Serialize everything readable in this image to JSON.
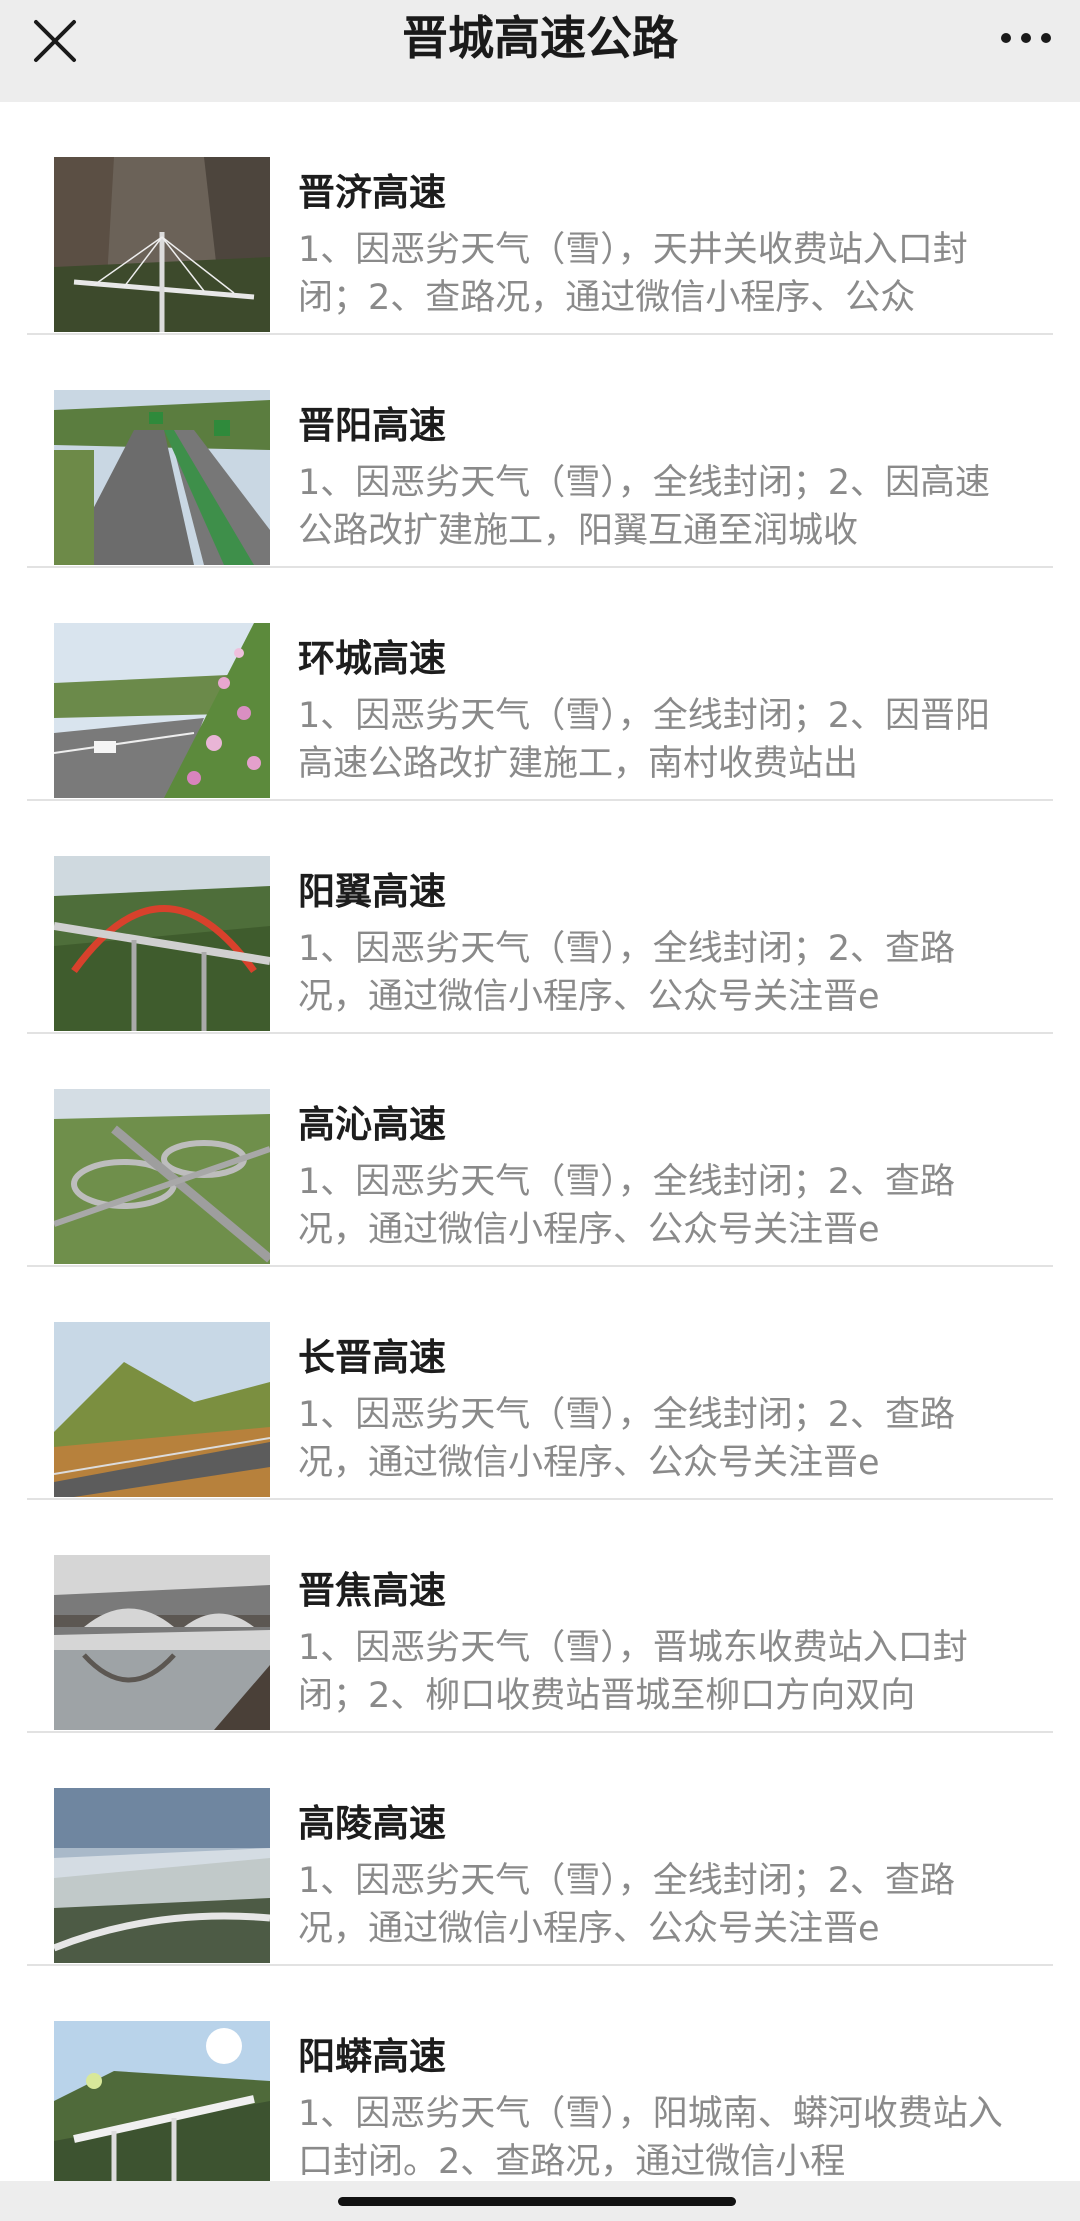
{
  "header": {
    "title": "晋城高速公路",
    "close_icon": "close-icon",
    "more_icon": "more-icon"
  },
  "roads": [
    {
      "name": "晋济高速",
      "desc": "1、因恶劣天气（雪），天井关收费站入口封闭；2、查路况，通过微信小程序、公众",
      "thumb": "bridge-cliff"
    },
    {
      "name": "晋阳高速",
      "desc": "1、因恶劣天气（雪），全线封闭；2、因高速公路改扩建施工，阳翼互通至润城收",
      "thumb": "highway-signs"
    },
    {
      "name": "环城高速",
      "desc": "1、因恶劣天气（雪），全线封闭；2、因晋阳高速公路改扩建施工，南村收费站出",
      "thumb": "highway-flowers"
    },
    {
      "name": "阳翼高速",
      "desc": "1、因恶劣天气（雪），全线封闭；2、查路况，通过微信小程序、公众号关注晋e",
      "thumb": "arch-bridge"
    },
    {
      "name": "高沁高速",
      "desc": "1、因恶劣天气（雪），全线封闭；2、查路况，通过微信小程序、公众号关注晋e",
      "thumb": "interchange"
    },
    {
      "name": "长晋高速",
      "desc": "1、因恶劣天气（雪），全线封闭；2、查路况，通过微信小程序、公众号关注晋e",
      "thumb": "mountain-road"
    },
    {
      "name": "晋焦高速",
      "desc": "1、因恶劣天气（雪），晋城东收费站入口封闭；2、柳口收费站晋城至柳口方向双向",
      "thumb": "stone-bridge"
    },
    {
      "name": "高陵高速",
      "desc": "1、因恶劣天气（雪），全线封闭；2、查路况，通过微信小程序、公众号关注晋e",
      "thumb": "misty-viaduct"
    },
    {
      "name": "阳蟒高速",
      "desc": "1、因恶劣天气（雪），阳城南、蟒河收费站入口封闭。2、查路况，通过微信小程",
      "thumb": "sunlit-viaduct"
    }
  ],
  "colors": {
    "header_bg": "#ededed",
    "title": "#1d1d1d",
    "desc": "#8a8a8a",
    "divider": "#e2e2e2"
  }
}
